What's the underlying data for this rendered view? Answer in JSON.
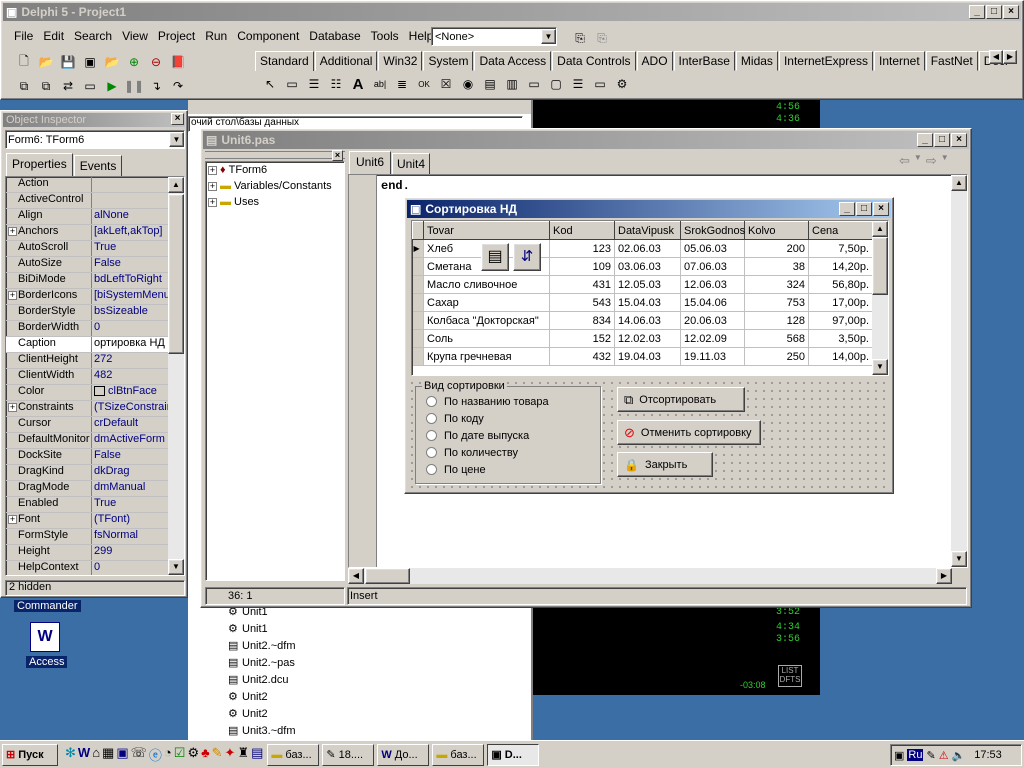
{
  "ide": {
    "title": "Delphi 5 - Project1",
    "menu": [
      "File",
      "Edit",
      "Search",
      "View",
      "Project",
      "Run",
      "Component",
      "Database",
      "Tools",
      "Help"
    ],
    "combo_value": "<None>",
    "palette_tabs": [
      "Standard",
      "Additional",
      "Win32",
      "System",
      "Data Access",
      "Data Controls",
      "ADO",
      "InterBase",
      "Midas",
      "InternetExpress",
      "Internet",
      "FastNet",
      "Decision C"
    ]
  },
  "inspector": {
    "title": "Object Inspector",
    "selected": "Form6: TForm6",
    "tabs": [
      "Properties",
      "Events"
    ],
    "props": [
      {
        "k": "Action",
        "v": ""
      },
      {
        "k": "ActiveControl",
        "v": ""
      },
      {
        "k": "Align",
        "v": "alNone"
      },
      {
        "k": "Anchors",
        "v": "[akLeft,akTop]",
        "plus": true
      },
      {
        "k": "AutoScroll",
        "v": "True"
      },
      {
        "k": "AutoSize",
        "v": "False"
      },
      {
        "k": "BiDiMode",
        "v": "bdLeftToRight"
      },
      {
        "k": "BorderIcons",
        "v": "[biSystemMenu,",
        "plus": true
      },
      {
        "k": "BorderStyle",
        "v": "bsSizeable"
      },
      {
        "k": "BorderWidth",
        "v": "0"
      },
      {
        "k": "Caption",
        "v": "ортировка НД",
        "sel": true
      },
      {
        "k": "ClientHeight",
        "v": "272"
      },
      {
        "k": "ClientWidth",
        "v": "482"
      },
      {
        "k": "Color",
        "v": "clBtnFace"
      },
      {
        "k": "Constraints",
        "v": "(TSizeConstrain",
        "plus": true
      },
      {
        "k": "Cursor",
        "v": "crDefault"
      },
      {
        "k": "DefaultMonitor",
        "v": "dmActiveForm"
      },
      {
        "k": "DockSite",
        "v": "False"
      },
      {
        "k": "DragKind",
        "v": "dkDrag"
      },
      {
        "k": "DragMode",
        "v": "dmManual"
      },
      {
        "k": "Enabled",
        "v": "True"
      },
      {
        "k": "Font",
        "v": "(TFont)",
        "plus": true
      },
      {
        "k": "FormStyle",
        "v": "fsNormal"
      },
      {
        "k": "Height",
        "v": "299"
      },
      {
        "k": "HelpContext",
        "v": "0"
      }
    ],
    "status": "2 hidden"
  },
  "editor": {
    "title": "Unit6.pas",
    "tree": [
      "TForm6",
      "Variables/Constants",
      "Uses"
    ],
    "tabs": [
      "Unit6",
      "Unit4"
    ],
    "code": "end.",
    "status_pos": "36:  1",
    "status_mode": "Insert"
  },
  "form": {
    "title": "Сортировка НД",
    "columns": [
      "Tovar",
      "Kod",
      "DataVipusk",
      "SrokGodnos",
      "Kolvo",
      "Cena"
    ],
    "rows": [
      [
        "Хлеб",
        "123",
        "02.06.03",
        "05.06.03",
        "200",
        "7,50р."
      ],
      [
        "Сметана",
        "109",
        "03.06.03",
        "07.06.03",
        "38",
        "14,20р."
      ],
      [
        "Масло сливочное",
        "431",
        "12.05.03",
        "12.06.03",
        "324",
        "56,80р."
      ],
      [
        "Сахар",
        "543",
        "15.04.03",
        "15.04.06",
        "753",
        "17,00р."
      ],
      [
        "Колбаса \"Докторская\"",
        "834",
        "14.06.03",
        "20.06.03",
        "128",
        "97,00р."
      ],
      [
        "Соль",
        "152",
        "12.02.03",
        "12.02.09",
        "568",
        "3,50р."
      ],
      [
        "Крупа гречневая",
        "432",
        "19.04.03",
        "19.11.03",
        "250",
        "14,00р."
      ]
    ],
    "group_title": "Вид сортировки",
    "radios": [
      "По названию товара",
      "По коду",
      "По дате выпуска",
      "По количеству",
      "По цене"
    ],
    "btn_sort": "Отсортировать",
    "btn_cancel": "Отменить сортировку",
    "btn_close": "Закрыть"
  },
  "background": {
    "path": "очий стол\\базы данных",
    "files": [
      "Unit1",
      "Unit1",
      "Unit2.~dfm",
      "Unit2.~pas",
      "Unit2.dcu",
      "Unit2",
      "Unit2",
      "Unit3.~dfm"
    ],
    "clock_times": [
      "4:56",
      "4:36",
      "3:52",
      "4:34",
      "3:56"
    ],
    "side_text": "икола...",
    "list_label": "LIST",
    "dfts_label": "DFTS",
    "small_time": "-03:08"
  },
  "desktop": {
    "icons": [
      "Commander",
      "Access"
    ]
  },
  "taskbar": {
    "start": "Пуск",
    "tasks": [
      "баз...",
      "18....",
      "До...",
      "баз...",
      "D..."
    ],
    "lang": "Ru",
    "time": "17:53"
  }
}
